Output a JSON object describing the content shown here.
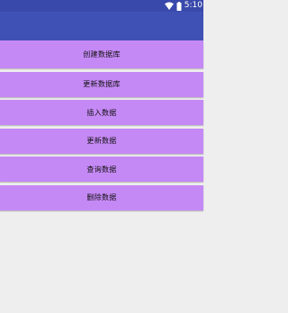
{
  "status_bar": {
    "time": "5:10",
    "icons": [
      "wifi-icon",
      "battery-icon"
    ]
  },
  "colors": {
    "status_bar": "#3949ab",
    "app_bar": "#3f51b5",
    "button": "#c589f5",
    "background": "#eeeeee"
  },
  "buttons": [
    {
      "label": "创建数据库"
    },
    {
      "label": "更新数据库"
    },
    {
      "label": "插入数据"
    },
    {
      "label": "更新数据"
    },
    {
      "label": "查询数据"
    },
    {
      "label": "删除数据"
    }
  ]
}
